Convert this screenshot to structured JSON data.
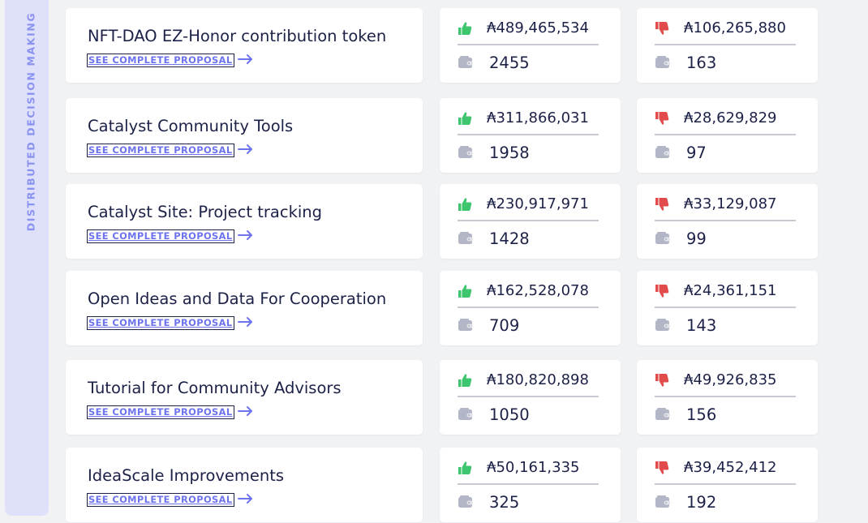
{
  "sidebar": {
    "label": "DISTRIBUTED DECISION MAKING"
  },
  "colors": {
    "accent": "#6d73ec",
    "yes": "#3dc66e",
    "no": "#e24b4b",
    "wallet": "#b3b6c6"
  },
  "icons": {
    "yes": "thumbs-up-icon",
    "no": "thumbs-down-icon",
    "wallet": "wallet-icon",
    "arrow": "arrow-right-icon"
  },
  "proposals": [
    {
      "title": "NFT-DAO EZ-Honor contribution token",
      "link": "SEE COMPLETE PROPOSAL",
      "yes_amount": "₳489,465,534",
      "yes_count": "2455",
      "no_amount": "₳106,265,880",
      "no_count": "163"
    },
    {
      "title": "Catalyst Community Tools",
      "link": "SEE COMPLETE PROPOSAL",
      "yes_amount": "₳311,866,031",
      "yes_count": "1958",
      "no_amount": "₳28,629,829",
      "no_count": "97"
    },
    {
      "title": "Catalyst Site: Project tracking",
      "link": "SEE COMPLETE PROPOSAL",
      "yes_amount": "₳230,917,971",
      "yes_count": "1428",
      "no_amount": "₳33,129,087",
      "no_count": "99"
    },
    {
      "title": "Open Ideas and Data For Cooperation",
      "link": "SEE COMPLETE PROPOSAL",
      "yes_amount": "₳162,528,078",
      "yes_count": "709",
      "no_amount": "₳24,361,151",
      "no_count": "143"
    },
    {
      "title": "Tutorial for Community Advisors",
      "link": "SEE COMPLETE PROPOSAL",
      "yes_amount": "₳180,820,898",
      "yes_count": "1050",
      "no_amount": "₳49,926,835",
      "no_count": "156"
    },
    {
      "title": "IdeaScale Improvements",
      "link": "SEE COMPLETE PROPOSAL",
      "yes_amount": "₳50,161,335",
      "yes_count": "325",
      "no_amount": "₳39,452,412",
      "no_count": "192"
    }
  ]
}
